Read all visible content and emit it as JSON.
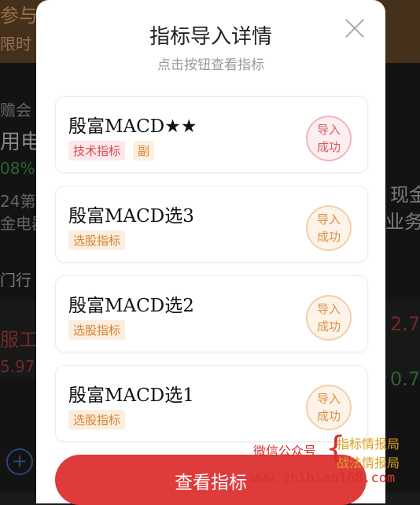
{
  "background": {
    "texts": [
      {
        "id": "t1",
        "text": "参与"
      },
      {
        "id": "t2",
        "text": "限时"
      },
      {
        "id": "t3",
        "text": "赡会"
      },
      {
        "id": "t4",
        "text": "用电"
      },
      {
        "id": "t5",
        "text": "08%"
      },
      {
        "id": "t6",
        "text": "24第"
      },
      {
        "id": "t7",
        "text": "金电器"
      },
      {
        "id": "t8",
        "text": "门行"
      },
      {
        "id": "t9",
        "text": "服工"
      },
      {
        "id": "t10",
        "text": "5.97%"
      },
      {
        "id": "t11",
        "text": "现金"
      },
      {
        "id": "t12",
        "text": "业务"
      },
      {
        "id": "t13",
        "text": "2.7"
      },
      {
        "id": "t14",
        "text": "0.7"
      }
    ]
  },
  "modal": {
    "title": "指标导入详情",
    "subtitle": "点击按钮查看指标",
    "items": [
      {
        "name": "殷富MACD★★",
        "tags": [
          {
            "label": "技术指标",
            "kind": "tech"
          },
          {
            "label": "副",
            "kind": "sub"
          }
        ],
        "status": "导入\n成功",
        "stamp_color": "red"
      },
      {
        "name": "殷富MACD选3",
        "tags": [
          {
            "label": "选股指标",
            "kind": "select"
          }
        ],
        "status": "导入\n成功",
        "stamp_color": "orange"
      },
      {
        "name": "殷富MACD选2",
        "tags": [
          {
            "label": "选股指标",
            "kind": "select"
          }
        ],
        "status": "导入\n成功",
        "stamp_color": "orange"
      },
      {
        "name": "殷富MACD选1",
        "tags": [
          {
            "label": "选股指标",
            "kind": "select"
          }
        ],
        "status": "导入\n成功",
        "stamp_color": "orange"
      }
    ],
    "view_button": "查看指标"
  },
  "watermark": {
    "wechat": "微信公众号",
    "line1": "指标情报局",
    "line2": "战法情报局",
    "url": "www.zhibiao168.com"
  },
  "colors": {
    "accent": "#de3b3b",
    "tag_tech": "#d84a4f",
    "tag_select": "#d9822b"
  }
}
